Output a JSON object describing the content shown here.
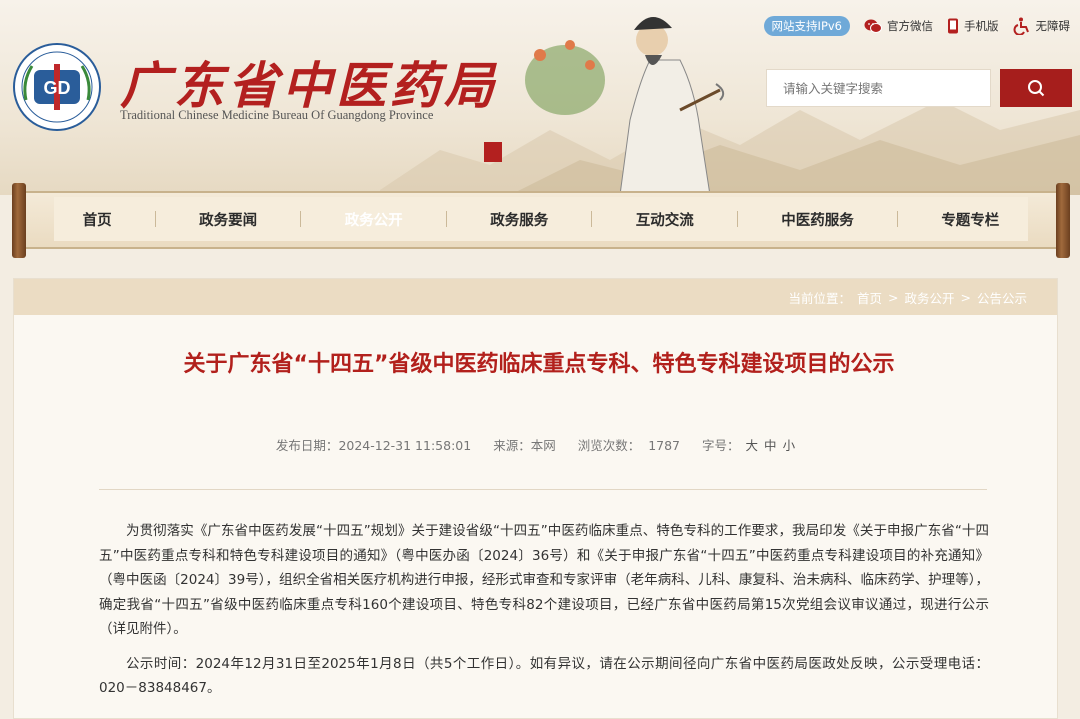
{
  "header": {
    "site_title": "广东省中医药局",
    "site_subtitle": "Traditional Chinese Medicine Bureau Of Guangdong Province",
    "logo_text": "GD",
    "logo_ring_text": "广东省中医药局",
    "topbar": {
      "ipv6": "网站支持IPv6",
      "wechat": "官方微信",
      "mobile": "手机版",
      "accessibility": "无障碍"
    },
    "search": {
      "placeholder": "请输入关键字搜索"
    }
  },
  "nav": {
    "items": [
      {
        "label": "首页"
      },
      {
        "label": "政务要闻"
      },
      {
        "label": "政务公开"
      },
      {
        "label": "政务服务"
      },
      {
        "label": "互动交流"
      },
      {
        "label": "中医药服务"
      },
      {
        "label": "专题专栏"
      }
    ],
    "active": "政务公开"
  },
  "breadcrumb": {
    "label": "当前位置：",
    "items": [
      "首页",
      "政务公开",
      "公告公示"
    ],
    "sep": ">"
  },
  "article": {
    "title": "关于广东省“十四五”省级中医药临床重点专科、特色专科建设项目的公示",
    "meta": {
      "date_label": "发布日期：",
      "date": "2024-12-31 11:58:01",
      "source_label": "来源：",
      "source": "本网",
      "views_label": "浏览次数：",
      "views": "1787",
      "font_label": "字号：",
      "font_large": "大",
      "font_medium": "中",
      "font_small": "小"
    },
    "paragraphs": [
      "为贯彻落实《广东省中医药发展“十四五”规划》关于建设省级“十四五”中医药临床重点、特色专科的工作要求，我局印发《关于申报广东省“十四五”中医药重点专科和特色专科建设项目的通知》（粤中医办函〔2024〕36号）和《关于申报广东省“十四五”中医药重点专科建设项目的补充通知》（粤中医函〔2024〕39号），组织全省相关医疗机构进行申报，经形式审查和专家评审（老年病科、儿科、康复科、治未病科、临床药学、护理等），确定我省“十四五”省级中医药临床重点专科160个建设项目、特色专科82个建设项目，已经广东省中医药局第15次党组会议审议通过，现进行公示（详见附件）。",
      "公示时间：2024年12月31日至2025年1月8日（共5个工作日）。如有异议，请在公示期间径向广东省中医药局医政处反映，公示受理电话：020－83848467。"
    ]
  },
  "colors": {
    "brand_red": "#b2201c",
    "nav_active_bg": "#8e1d1a",
    "ipv6_badge": "#6fa9d8"
  },
  "icons": [
    "wechat-icon",
    "mobile-icon",
    "accessibility-icon",
    "search-icon",
    "logo-emblem-icon",
    "seal-icon"
  ]
}
